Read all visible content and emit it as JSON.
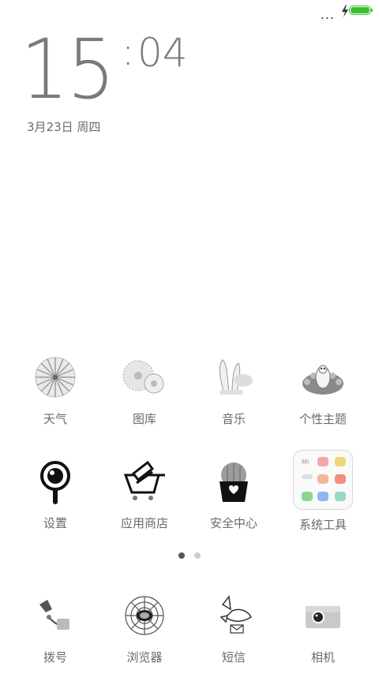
{
  "status_bar": {
    "signal": "...",
    "battery_color": "#3bbf2e"
  },
  "clock": {
    "hours": "15",
    "minutes": "04",
    "date": "3月23日 周四"
  },
  "apps_row1": [
    {
      "label": "天气",
      "icon": "weather-umbrella-icon"
    },
    {
      "label": "图库",
      "icon": "gallery-gears-icon"
    },
    {
      "label": "音乐",
      "icon": "music-rabbit-icon"
    },
    {
      "label": "个性主题",
      "icon": "themes-peacock-icon"
    }
  ],
  "apps_row2": [
    {
      "label": "设置",
      "icon": "settings-eye-icon"
    },
    {
      "label": "应用商店",
      "icon": "app-store-cart-icon"
    },
    {
      "label": "安全中心",
      "icon": "security-cactus-icon"
    },
    {
      "label": "系统工具",
      "icon": "system-tools-folder-icon",
      "folder_badge": "MI"
    }
  ],
  "page_indicator": {
    "total": 2,
    "active": 1
  },
  "dock": [
    {
      "label": "拨号",
      "icon": "phone-icon"
    },
    {
      "label": "浏览器",
      "icon": "browser-spiderweb-icon"
    },
    {
      "label": "短信",
      "icon": "messages-bird-icon"
    },
    {
      "label": "相机",
      "icon": "camera-icon"
    }
  ]
}
